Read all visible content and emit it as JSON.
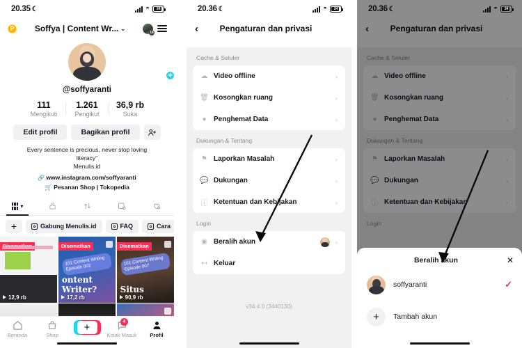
{
  "status_bar": {
    "time_left": "20.35",
    "time_mid": "20.36",
    "time_right": "20.36",
    "moon": "☾",
    "battery_level": "24",
    "wifi_icon": "wifi-icon",
    "signal_icon": "signal-icon"
  },
  "profile": {
    "header": {
      "pro_badge": "P",
      "title": "Soffya | Content Wr...",
      "chevron": "⌄",
      "avatar_badge": "18",
      "menu_icon": "hamburger-icon"
    },
    "handle": "@soffyaranti",
    "avatar_plus": "+",
    "stats": [
      {
        "value": "111",
        "label": "Mengikuti"
      },
      {
        "value": "1.261",
        "label": "Pengikut"
      },
      {
        "value": "36,9 rb",
        "label": "Suka"
      }
    ],
    "buttons": {
      "edit": "Edit profil",
      "share": "Bagikan profil",
      "add_friend_icon": "add-person-icon"
    },
    "bio_line1": "Every sentence is precious, never stop loving",
    "bio_line2": "literacy\"",
    "bio_line3": "Menulis.id",
    "bio_link": "www.instagram.com/soffyaranti",
    "bio_shop": "Pesanan Shop | Tokopedia",
    "link_icon": "link-icon",
    "shop_icon": "shopping-cart-icon",
    "tabs": [
      {
        "name": "grid",
        "icon": "grid-icon"
      },
      {
        "name": "private",
        "icon": "lock-icon"
      },
      {
        "name": "repost",
        "icon": "repost-icon"
      },
      {
        "name": "tagged",
        "icon": "tagged-icon"
      },
      {
        "name": "liked",
        "icon": "heart-icon"
      }
    ],
    "chips": [
      {
        "label": "+",
        "icon": "plus-icon"
      },
      {
        "label": "Gabung Menulis.id",
        "icon": "playlist-icon"
      },
      {
        "label": "FAQ",
        "icon": "playlist-icon"
      },
      {
        "label": "Cara",
        "icon": "playlist-icon"
      }
    ],
    "videos": [
      {
        "pin": "Disematkan",
        "views": "12,9 rb",
        "overlay": "",
        "big": ""
      },
      {
        "pin": "Disematkan",
        "views": "17,2 rb",
        "overlay": "101 Content Writing Episode 002",
        "big": "ontent Writer?"
      },
      {
        "pin": "Disematkan",
        "views": "90,9 rb",
        "overlay": "101 Content Writing Episode 007",
        "big": "Situs"
      }
    ],
    "nav": [
      {
        "label": "Beranda",
        "icon": "home-icon",
        "badge": ""
      },
      {
        "label": "Shop",
        "icon": "shop-bag-icon",
        "badge": ""
      },
      {
        "label": "",
        "icon": "create-plus-icon",
        "badge": ""
      },
      {
        "label": "Kotak Masuk",
        "icon": "inbox-icon",
        "badge": "4"
      },
      {
        "label": "Profil",
        "icon": "person-icon",
        "badge": ""
      }
    ]
  },
  "settings": {
    "back_icon": "back-chevron-icon",
    "title": "Pengaturan dan privasi",
    "sections": [
      {
        "label": "Cache & Seluler",
        "rows": [
          {
            "label": "Video offline",
            "icon": "cloud-download-icon"
          },
          {
            "label": "Kosongkan ruang",
            "icon": "trash-icon"
          },
          {
            "label": "Penghemat Data",
            "icon": "data-saver-icon"
          }
        ]
      },
      {
        "label": "Dukungan & Tentang",
        "rows": [
          {
            "label": "Laporkan Masalah",
            "icon": "flag-icon"
          },
          {
            "label": "Dukungan",
            "icon": "chat-icon"
          },
          {
            "label": "Ketentuan dan Kebijakan",
            "icon": "info-icon"
          }
        ]
      },
      {
        "label": "Login",
        "rows": [
          {
            "label": "Beralih akun",
            "icon": "switch-account-icon"
          },
          {
            "label": "Keluar",
            "icon": "logout-icon"
          }
        ]
      }
    ],
    "version": "v34.4.0 (3440130)",
    "chevron": "›"
  },
  "switch_sheet": {
    "title": "Beralih akun",
    "close_icon": "close-icon",
    "accounts": [
      {
        "name": "soffyaranti",
        "selected_check": "✓"
      }
    ],
    "add_account": {
      "label": "Tambah akun",
      "icon": "plus-icon"
    }
  },
  "colors": {
    "accent_red": "#fe2c55",
    "accent_cyan": "#20d5ec",
    "pro_gold": "#ffb300",
    "bg_grey": "#f1f1f2"
  }
}
